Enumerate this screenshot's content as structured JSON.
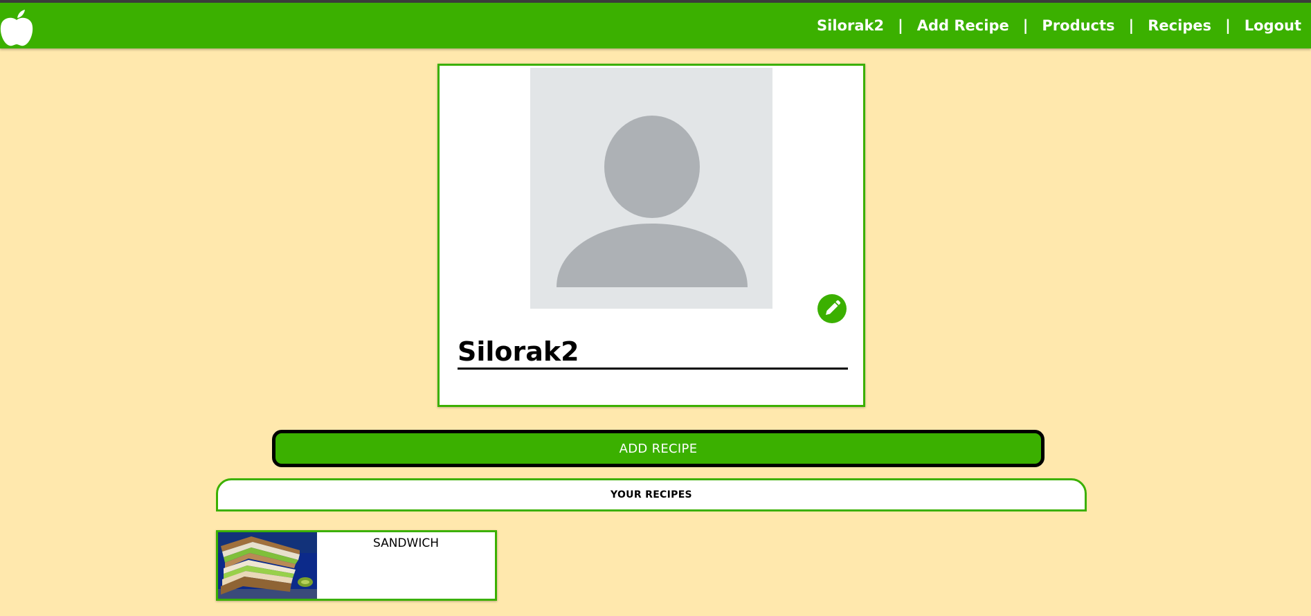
{
  "header": {
    "logo_icon": "apple-icon",
    "nav": [
      {
        "label": "Silorak2"
      },
      {
        "label": "Add Recipe"
      },
      {
        "label": "Products"
      },
      {
        "label": "Recipes"
      },
      {
        "label": "Logout"
      }
    ],
    "separator": "|"
  },
  "profile": {
    "avatar_icon": "default-avatar-icon",
    "edit_icon": "pencil-icon",
    "username": "Silorak2"
  },
  "actions": {
    "add_recipe_label": "ADD RECIPE"
  },
  "recipes_section": {
    "title": "YOUR RECIPES",
    "items": [
      {
        "title": "SANDWICH",
        "image_icon": "sandwich-photo"
      }
    ]
  },
  "colors": {
    "brand_green": "#3bb000",
    "page_background": "#ffe8ad",
    "avatar_background": "#e2e5e7",
    "avatar_silhouette": "#adb1b5"
  }
}
